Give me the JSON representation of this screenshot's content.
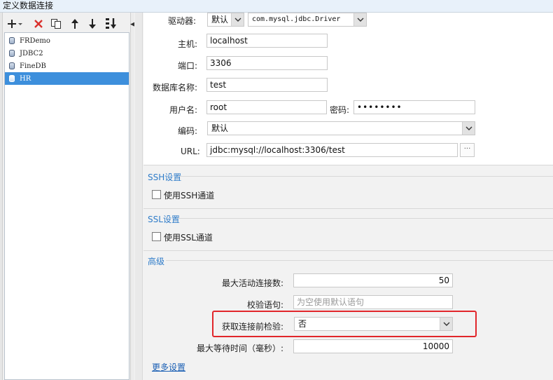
{
  "window": {
    "title": "定义数据连接"
  },
  "toolbar": {
    "add_icon": "plus-icon",
    "delete_icon": "close-icon",
    "copy_icon": "copy-icon",
    "up_icon": "arrow-up-icon",
    "down_icon": "arrow-down-icon",
    "sort_icon": "sort-icon"
  },
  "connections": [
    {
      "name": "FRDemo",
      "selected": false
    },
    {
      "name": "JDBC2",
      "selected": false
    },
    {
      "name": "FineDB",
      "selected": false
    },
    {
      "name": "HR",
      "selected": true
    }
  ],
  "form": {
    "driver_label": "驱动器:",
    "driver_mode": "默认",
    "driver_class": "com.mysql.jdbc.Driver",
    "host_label": "主机:",
    "host_value": "localhost",
    "port_label": "端口:",
    "port_value": "3306",
    "dbname_label": "数据库名称:",
    "dbname_value": "test",
    "user_label": "用户名:",
    "user_value": "root",
    "password_label": "密码:",
    "password_value": "••••••••",
    "encoding_label": "编码:",
    "encoding_value": "默认",
    "url_label": "URL:",
    "url_value": "jdbc:mysql://localhost:3306/test",
    "url_button": "···"
  },
  "ssh": {
    "title": "SSH设置",
    "checkbox_label": "使用SSH通道",
    "checked": false
  },
  "ssl": {
    "title": "SSL设置",
    "checkbox_label": "使用SSL通道",
    "checked": false
  },
  "advanced": {
    "title": "高级",
    "max_active_label": "最大活动连接数:",
    "max_active_value": "50",
    "validation_query_label": "校验语句:",
    "validation_query_placeholder": "为空使用默认语句",
    "test_before_label": "获取连接前检验:",
    "test_before_value": "否",
    "max_wait_label": "最大等待时间（毫秒）:",
    "max_wait_value": "10000",
    "more_link": "更多设置"
  },
  "colors": {
    "accent": "#2f7cc9",
    "selection": "#3d8fdc",
    "highlight_box": "#e1262b"
  }
}
